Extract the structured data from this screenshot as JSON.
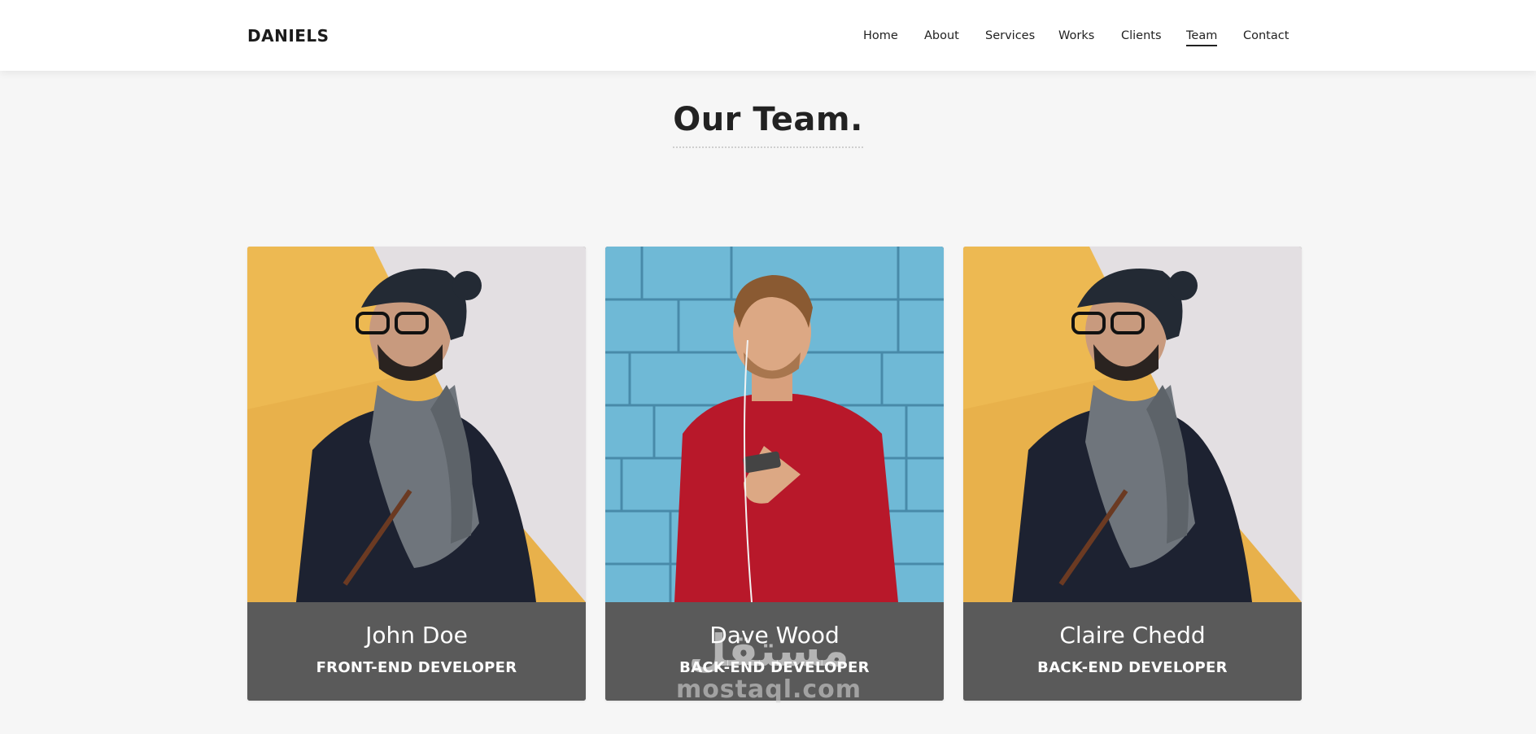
{
  "header": {
    "brand": "DANIELS",
    "nav": [
      {
        "label": "Home"
      },
      {
        "label": "About"
      },
      {
        "label": "Services"
      },
      {
        "label": "Works"
      },
      {
        "label": "Clients"
      },
      {
        "label": "Team",
        "active": true
      },
      {
        "label": "Contact"
      }
    ]
  },
  "section": {
    "title": "Our Team."
  },
  "team": [
    {
      "name": "John Doe",
      "role": "FRONT-END DEVELOPER",
      "photo": "man-beanie-scarf-yellow-wall"
    },
    {
      "name": "Dave Wood",
      "role": "BACK-END DEVELOPER",
      "photo": "man-red-sweater-blue-wall"
    },
    {
      "name": "Claire Chedd",
      "role": "BACK-END DEVELOPER",
      "photo": "man-beanie-scarf-yellow-wall"
    }
  ],
  "watermark": {
    "arabic": "مستقل",
    "latin": "mostaql.com"
  },
  "colors": {
    "background": "#f6f6f6",
    "navbar": "#ffffff",
    "card_footer": "#5a5a5a",
    "text_dark": "#222222"
  }
}
